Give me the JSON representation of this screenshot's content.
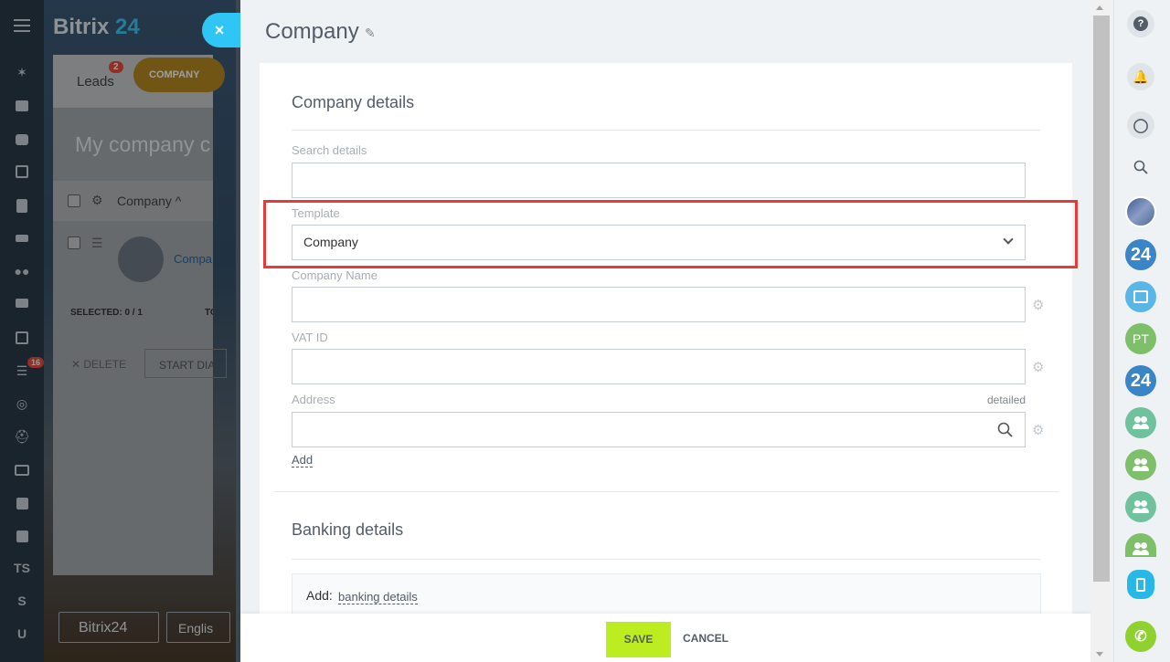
{
  "app": {
    "logo_main": "Bitrix",
    "logo_num": "24"
  },
  "leftbar": {
    "badge": "16",
    "text_items": [
      "TS",
      "S",
      "U"
    ]
  },
  "crm": {
    "tabs": {
      "leads_label": "Leads",
      "leads_badge": "2",
      "company_label": "COMPANY"
    },
    "page_title": "My company c",
    "grid": {
      "column_label": "Company ^",
      "row_link": "Compa"
    },
    "selected_label": "SELECTED: 0 / 1",
    "to_label": "TO",
    "delete_label": "✕ DELETE",
    "start_dialog_label": "START DIA",
    "footer_logo": "Bitrix24",
    "footer_lang": "Englis"
  },
  "slider": {
    "title": "Company",
    "close_icon": "×",
    "company_details": {
      "section_title": "Company details",
      "search_label": "Search details",
      "search_value": "",
      "template_label": "Template",
      "template_value": "Company",
      "company_name_label": "Company Name",
      "company_name_value": "",
      "vat_label": "VAT ID",
      "vat_value": "",
      "address_label": "Address",
      "address_value": "",
      "detailed_link": "detailed",
      "add_link": "Add"
    },
    "banking_details": {
      "section_title": "Banking details",
      "add_prefix": "Add:",
      "add_link": "banking details"
    },
    "footer": {
      "save_label": "SAVE",
      "cancel_label": "CANCEL"
    }
  },
  "rightbar": {
    "help_icon": "?",
    "chat_initials": "PT",
    "bitrix_badge": "24"
  },
  "colors": {
    "accent_blue": "#2fc6f6",
    "save_green": "#bbed21",
    "highlight_red": "#e43b3b"
  }
}
